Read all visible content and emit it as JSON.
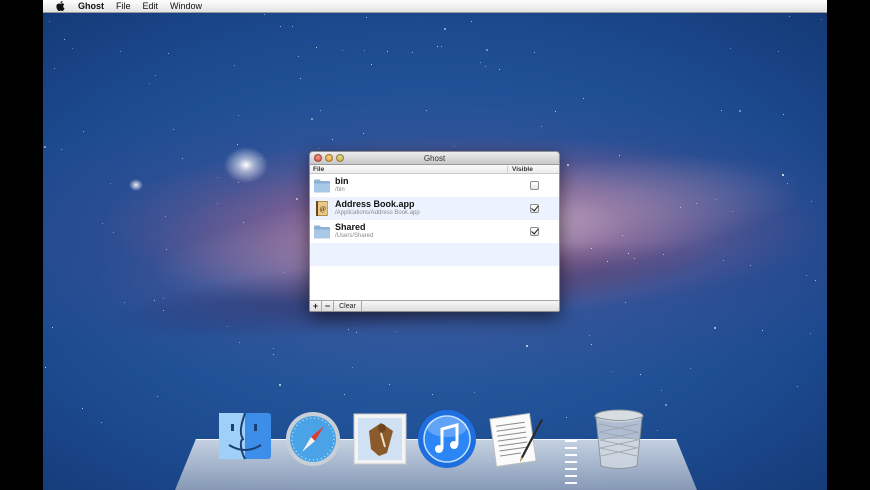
{
  "menubar": {
    "app_name": "Ghost",
    "items": [
      "File",
      "Edit",
      "Window"
    ]
  },
  "window": {
    "title": "Ghost",
    "columns": {
      "file": "File",
      "visible": "Visible"
    },
    "rows": [
      {
        "name": "bin",
        "path": "/bin",
        "icon": "folder-icon",
        "visible": false
      },
      {
        "name": "Address Book.app",
        "path": "/Applications/Address Book.app",
        "icon": "address-book-icon",
        "visible": true
      },
      {
        "name": "Shared",
        "path": "/Users/Shared",
        "icon": "folder-icon",
        "visible": true
      }
    ],
    "buttons": {
      "add": "+",
      "remove": "−",
      "clear": "Clear"
    }
  },
  "dock": {
    "icons": [
      "finder-icon",
      "safari-icon",
      "mail-icon",
      "itunes-icon",
      "textedit-icon",
      "trash-icon"
    ]
  },
  "colors": {
    "selection_row": "#edf3fe",
    "itunes_blue": "#1f6ee0"
  }
}
